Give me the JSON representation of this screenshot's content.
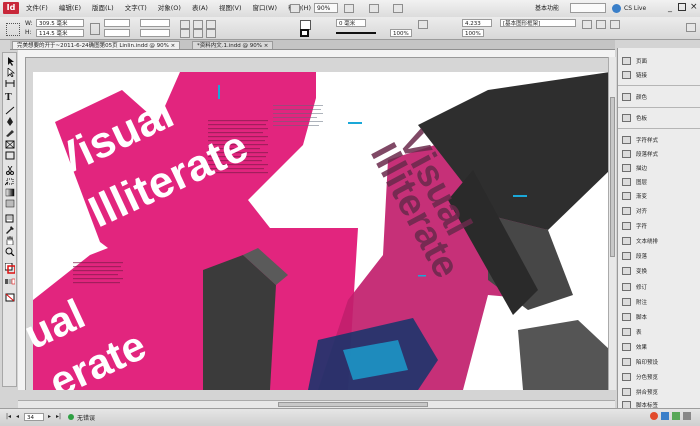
{
  "menubar": {
    "logo": "Id",
    "items": [
      "文件(F)",
      "编辑(E)",
      "版面(L)",
      "文字(T)",
      "对象(O)",
      "表(A)",
      "视图(V)",
      "窗口(W)",
      "帮助(H)"
    ],
    "zoom": "90%",
    "workspace": "基本功能",
    "search_placeholder": "",
    "cs_live": "CS Live"
  },
  "control": {
    "width_value": "309.5 毫米",
    "height_value": "114.5 毫米",
    "stroke_weight": "0 毫米",
    "percent_a": "100%",
    "percent_b": "100%",
    "stroke_value": "4.233",
    "style_name": "[基本图形框架]"
  },
  "tabs": [
    {
      "label": "完美想要的开于~2011-6-24确图第05页 Linlin.indd @ 90% ×"
    },
    {
      "label": "*资料内文.1.indd @ 90% ×"
    }
  ],
  "artwork": {
    "line1": "Visual",
    "line2": "Illiterate",
    "line3": "ual",
    "line4": "erate",
    "mirror1": "Visual",
    "mirror2": "Illiterate",
    "colors": {
      "magenta": "#e2257e",
      "dark": "#3a3a3a",
      "cyan": "#1aa8d8"
    }
  },
  "panel": {
    "items": [
      "页面",
      "链接",
      "颜色",
      "色板",
      "字符样式",
      "段落样式",
      "描边",
      "图层",
      "渐变",
      "对齐",
      "字符",
      "文本绕排",
      "段落",
      "变换",
      "修订",
      "附注",
      "脚本",
      "表",
      "效果",
      "陷印预设",
      "分色预览",
      "拼合预览",
      "脚本标签"
    ]
  },
  "status": {
    "page": "34",
    "preflight": "无错误"
  }
}
